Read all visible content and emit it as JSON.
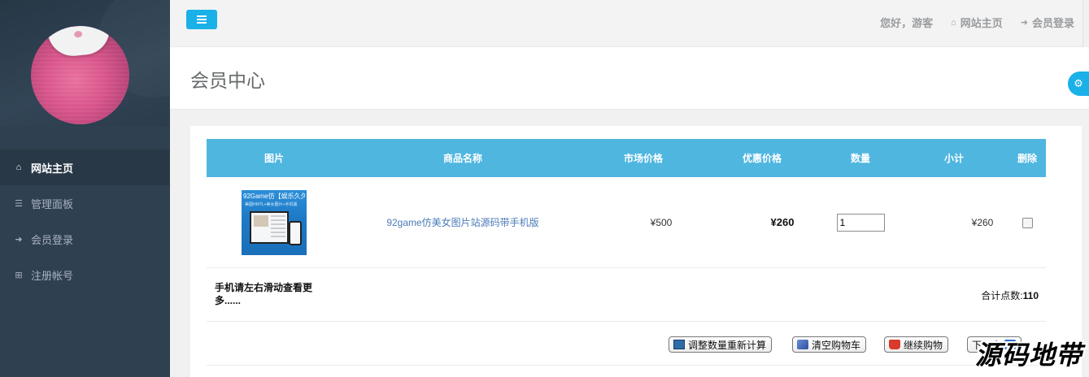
{
  "sidebar": {
    "items": [
      {
        "icon": "home-icon",
        "label": "网站主页",
        "active": true
      },
      {
        "icon": "list-icon",
        "label": "管理面板"
      },
      {
        "icon": "sign-in-icon",
        "label": "会员登录"
      },
      {
        "icon": "plus-square-icon",
        "label": "注册帐号"
      }
    ]
  },
  "topbar": {
    "greeting": "您好，游客",
    "home_link": "网站主页",
    "login_link": "会员登录"
  },
  "page": {
    "title": "会员中心"
  },
  "cart": {
    "headers": [
      "图片",
      "商品名称",
      "市场价格",
      "优惠价格",
      "数量",
      "小计",
      "删除"
    ],
    "items": [
      {
        "thumb_title": "92Game仿【娱乐久久久",
        "thumb_subtitle": "美图HMTL+美女图片+手机版",
        "name": "92game仿美女图片站源码带手机版",
        "market_price": "¥500",
        "sale_price": "¥260",
        "quantity": "1",
        "subtotal": "¥260",
        "delete_checked": false
      }
    ],
    "mobile_note": "手机请左右滑动查看更多......",
    "total_label": "合计点数:",
    "total_value": "110",
    "buttons": {
      "recalc": "调整数量重新计算",
      "clear": "清空购物车",
      "continue": "继续购物",
      "next": "下一步"
    }
  },
  "watermark": "源码地带",
  "colors": {
    "sidebar_bg": "#2f4050",
    "accent": "#1ab0e8",
    "table_header": "#4fb6e0",
    "link": "#4a7bb7"
  }
}
